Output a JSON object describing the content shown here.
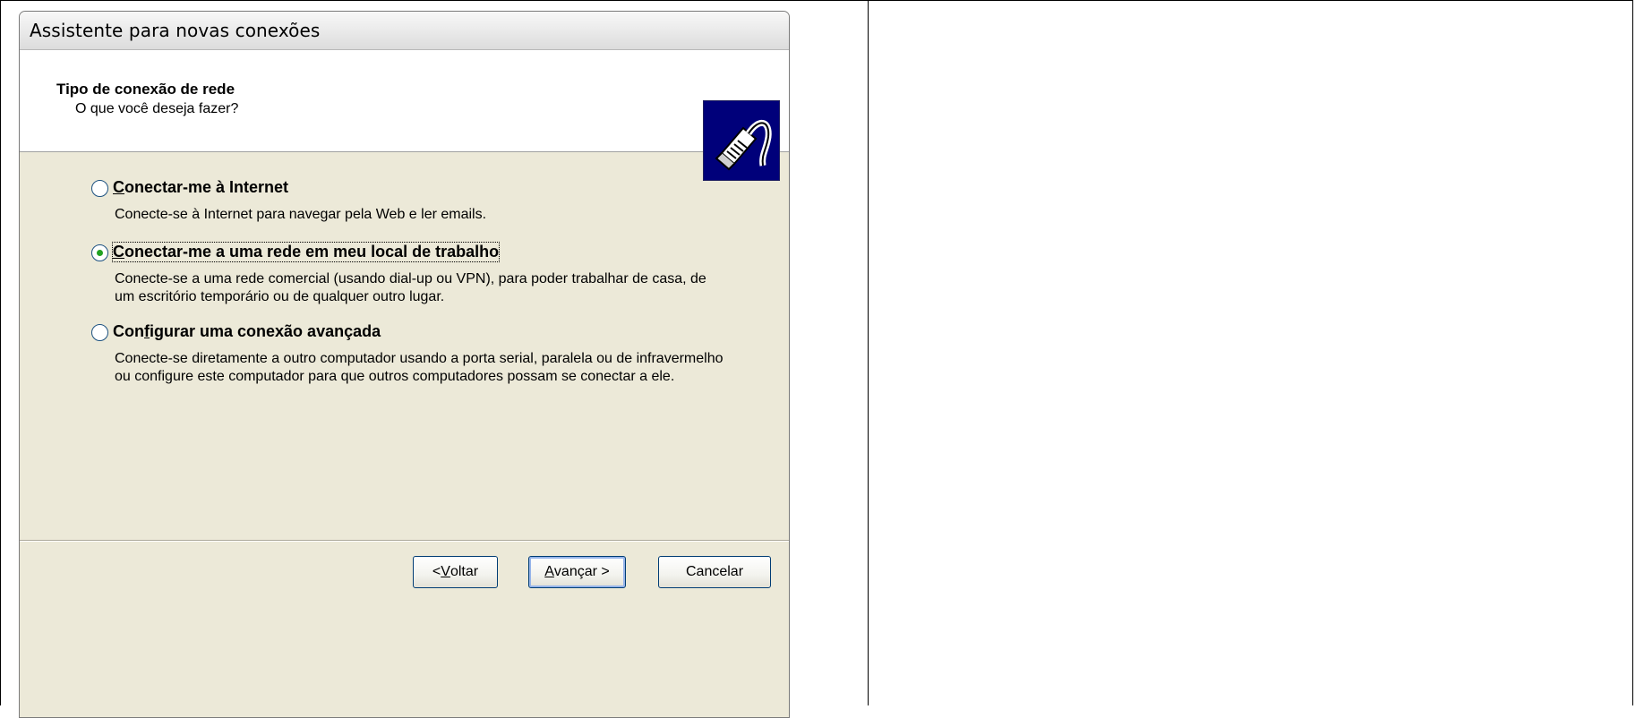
{
  "window": {
    "title": "Assistente para novas conexões"
  },
  "header": {
    "title": "Tipo de conexão de rede",
    "subtitle": "O que você deseja fazer?",
    "icon": "network-cable-icon"
  },
  "options": [
    {
      "label_first": "C",
      "label_rest": "onectar-me à Internet",
      "description": "Conecte-se à Internet para navegar pela Web e ler emails.",
      "selected": false
    },
    {
      "label_first": "C",
      "label_rest": "onectar-me a uma rede em meu local de trabalho",
      "description": "Conecte-se a uma rede comercial (usando dial-up ou VPN), para poder trabalhar de casa, de um escritório temporário ou de qualquer outro lugar.",
      "selected": true
    },
    {
      "label_first_plain": "Con",
      "label_underline": "f",
      "label_rest": "igurar uma conexão avançada",
      "description": "Conecte-se diretamente a outro computador usando a porta serial, paralela ou de infravermelho ou configure este computador para que outros computadores possam se conectar a ele.",
      "selected": false
    }
  ],
  "buttons": {
    "back_prefix": "< ",
    "back_underline": "V",
    "back_rest": "oltar",
    "next_underline": "A",
    "next_rest": "vançar >",
    "cancel": "Cancelar"
  },
  "colors": {
    "dialog_bg": "#ece9d8",
    "radio_dot": "#21a121",
    "icon_bg": "#00007a"
  }
}
